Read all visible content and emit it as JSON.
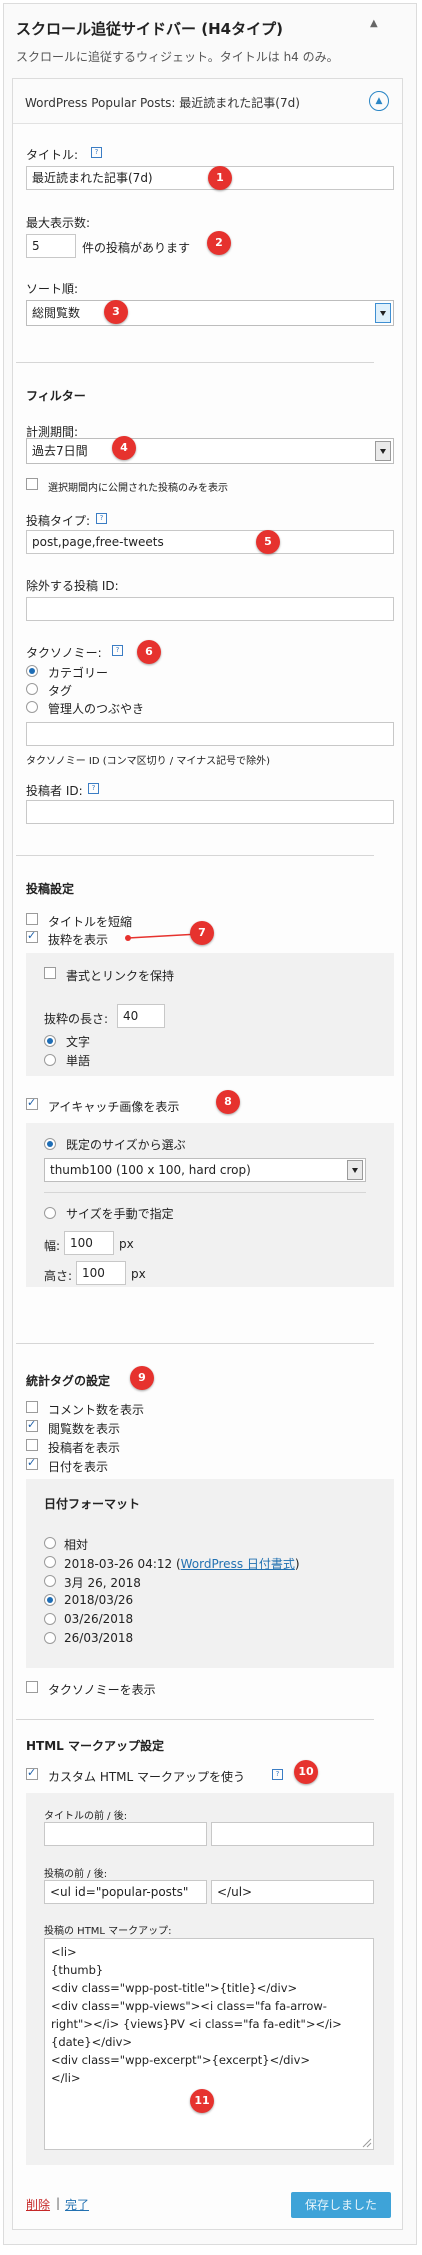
{
  "widget": {
    "title": "スクロール追従サイドバー (H4タイプ)",
    "description": "スクロールに追従するウィジェット。タイトルは h4 のみ。"
  },
  "plugin": {
    "header_title": "WordPress Popular Posts: 最近読まれた記事(7d)"
  },
  "badges": [
    "1",
    "2",
    "3",
    "4",
    "5",
    "6",
    "7",
    "8",
    "9",
    "10",
    "11"
  ],
  "help_glyph": "?",
  "general": {
    "title_label": "タイトル:",
    "title_value": "最近読まれた記事(7d)",
    "limit_label": "最大表示数:",
    "limit_value": "5",
    "limit_suffix": "件の投稿があります",
    "sort_label": "ソート順:",
    "sort_value": "総閲覧数"
  },
  "filters": {
    "heading": "フィルター",
    "range_label": "計測期間:",
    "range_value": "過去7日間",
    "freshness_label": "選択期間内に公開された投稿のみを表示",
    "post_type_label": "投稿タイプ:",
    "post_type_value": "post,page,free-tweets",
    "exclude_label": "除外する投稿 ID:",
    "exclude_value": "",
    "taxonomy_label": "タクソノミー:",
    "taxonomy_options": [
      "カテゴリー",
      "タグ",
      "管理人のつぶやき"
    ],
    "taxonomy_selected": "カテゴリー",
    "taxonomy_ids_value": "",
    "taxonomy_ids_note": "タクソノミー ID (コンマ区切り / マイナス記号で除外)",
    "author_label": "投稿者 ID:",
    "author_value": ""
  },
  "posts_settings": {
    "heading": "投稿設定",
    "shorten_title_label": "タイトルを短縮",
    "shorten_title_checked": false,
    "excerpt_label": "抜粋を表示",
    "excerpt_checked": true,
    "keep_format_label": "書式とリンクを保持",
    "keep_format_checked": false,
    "excerpt_length_label": "抜粋の長さ:",
    "excerpt_length_value": "40",
    "excerpt_unit_options": [
      "文字",
      "単語"
    ],
    "excerpt_unit_selected": "文字",
    "thumbnail_label": "アイキャッチ画像を表示",
    "thumbnail_checked": true,
    "thumb_predefined_label": "既定のサイズから選ぶ",
    "thumb_size_value": "thumb100 (100 x 100, hard crop)",
    "thumb_manual_label": "サイズを手動で指定",
    "width_label": "幅:",
    "width_value": "100",
    "height_label": "高さ:",
    "height_value": "100",
    "px": "px"
  },
  "stats_tag": {
    "heading": "統計タグの設定",
    "items": [
      {
        "label": "コメント数を表示",
        "checked": false
      },
      {
        "label": "閲覧数を表示",
        "checked": true
      },
      {
        "label": "投稿者を表示",
        "checked": false
      },
      {
        "label": "日付を表示",
        "checked": true
      }
    ],
    "date_format_heading": "日付フォーマット",
    "date_formats": [
      {
        "label": "相対",
        "checked": false
      },
      {
        "label": "2018-03-26 04:12",
        "link": "WordPress 日付書式",
        "checked": false
      },
      {
        "label": "3月 26, 2018",
        "checked": false
      },
      {
        "label": "2018/03/26",
        "checked": true
      },
      {
        "label": "03/26/2018",
        "checked": false
      },
      {
        "label": "26/03/2018",
        "checked": false
      }
    ],
    "taxonomy_label": "タクソノミーを表示",
    "taxonomy_checked": false
  },
  "markup": {
    "heading": "HTML マークアップ設定",
    "custom_label": "カスタム HTML マークアップを使う",
    "custom_checked": true,
    "title_wrap_label": "タイトルの前 / 後:",
    "title_before": "",
    "title_after": "",
    "posts_wrap_label": "投稿の前 / 後:",
    "posts_before": "<ul id=\"popular-posts\"",
    "posts_after": "</ul>",
    "post_html_label": "投稿の HTML マークアップ:",
    "post_html_lines": [
      "<li>",
      "{thumb}",
      "<div class=\"wpp-post-title\">{title}</div>",
      "<div class=\"wpp-views\"><i class=\"fa fa-arrow-",
      "right\"></i> {views}PV    <i class=\"fa fa-edit\"></i>",
      "{date}</div>",
      "<div class=\"wpp-excerpt\">{excerpt}</div>",
      "</li>"
    ]
  },
  "footer": {
    "delete_label": "削除",
    "separator": "|",
    "done_label": "完了",
    "save_label": "保存しました"
  },
  "colors": {
    "badge": "#e6322e",
    "save_button": "#3ea3d8",
    "link": "#2271b1",
    "delete_link": "#c62828"
  }
}
